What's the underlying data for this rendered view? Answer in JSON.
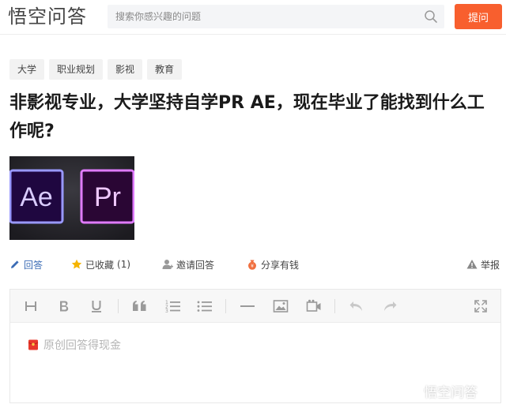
{
  "header": {
    "logo": "悟空问答",
    "search": {
      "placeholder": "搜索你感兴趣的问题"
    },
    "ask_label": "提问"
  },
  "tags": [
    "大学",
    "职业规划",
    "影视",
    "教育"
  ],
  "question": {
    "title": "非影视专业，大学坚持自学PR AE，现在毕业了能找到什么工作呢?",
    "image": {
      "left_logo": "Ae",
      "right_logo": "Pr"
    }
  },
  "actions": {
    "answer": "回答",
    "favorited": "已收藏",
    "favorite_count": "(1)",
    "invite": "邀请回答",
    "share": "分享有钱",
    "report": "举报"
  },
  "editor": {
    "toolbar": [
      "heading-icon",
      "bold-icon",
      "underline-icon",
      "quote-icon",
      "ordered-list-icon",
      "unordered-list-icon",
      "divider-icon",
      "image-icon",
      "video-icon",
      "undo-icon",
      "redo-icon",
      "fullscreen-icon"
    ],
    "placeholder": "原创回答得现金"
  },
  "watermark": "悟空问答",
  "colors": {
    "accent_orange": "#f85f2e",
    "link_blue": "#3b6cb5",
    "ae_purple": "#9999ff",
    "pr_magenta": "#e07bff"
  }
}
